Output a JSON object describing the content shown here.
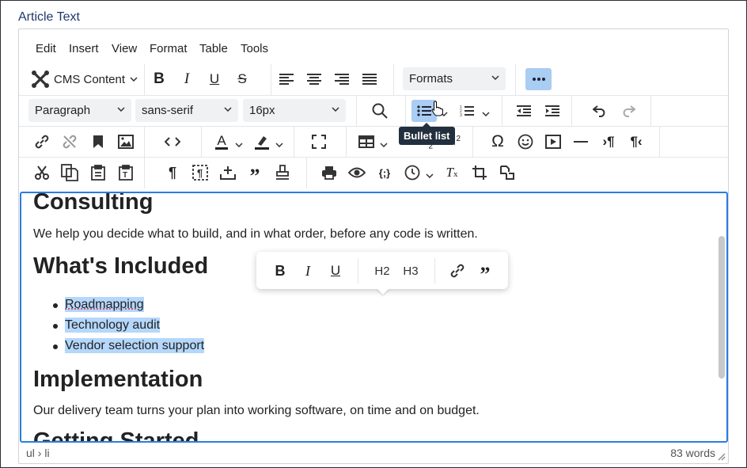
{
  "field_label": "Article Text",
  "menubar": {
    "items": [
      "Edit",
      "Insert",
      "View",
      "Format",
      "Table",
      "Tools"
    ]
  },
  "toolbar": {
    "cms_content_label": "CMS Content",
    "formats_label": "Formats",
    "block_format": "Paragraph",
    "font_family": "sans-serif",
    "font_size": "16px",
    "tooltip": "Bullet list",
    "subscript_label": "2",
    "superscript_label": "2"
  },
  "content": {
    "h1_consulting": "Consulting",
    "p_consulting": "We help you decide what to build, and in what order, before any code is written.",
    "h1_included": "What's Included",
    "list": [
      "Roadmapping",
      "Technology audit",
      "Vendor selection support"
    ],
    "h1_implementation": "Implementation",
    "p_implementation": "Our delivery team turns your plan into working software, on time and on budget.",
    "h1_partial": "Getting Started"
  },
  "floating_toolbar": {
    "h2": "H2",
    "h3": "H3"
  },
  "status": {
    "path": "ul › li",
    "word_count": "83 words"
  },
  "colors": {
    "accent": "#2a7de1",
    "selection": "#b4d7fb",
    "tooltip_bg": "#222f3e"
  },
  "icons": [
    "joomla-icon",
    "bold-icon",
    "italic-icon",
    "underline-icon",
    "strikethrough-icon",
    "align-left-icon",
    "align-center-icon",
    "align-right-icon",
    "justify-icon",
    "more-icon",
    "search-icon",
    "bullet-list-icon",
    "numbered-list-icon",
    "outdent-icon",
    "indent-icon",
    "undo-icon",
    "redo-icon",
    "link-icon",
    "unlink-icon",
    "bookmark-icon",
    "image-icon",
    "code-icon",
    "text-color-icon",
    "highlight-icon",
    "fullscreen-icon",
    "table-icon",
    "omega-icon",
    "emoji-icon",
    "media-icon",
    "hr-icon",
    "ltr-icon",
    "rtl-icon",
    "cut-icon",
    "copy-icon",
    "paste-icon",
    "paste-text-icon",
    "pilcrow-icon",
    "template-icon",
    "insert-icon",
    "blockquote-icon",
    "stamp-icon",
    "print-icon",
    "preview-icon",
    "code-sample-icon",
    "clock-icon",
    "clear-format-icon",
    "crop-icon",
    "crop-alt-icon",
    "resize-handle-icon"
  ]
}
